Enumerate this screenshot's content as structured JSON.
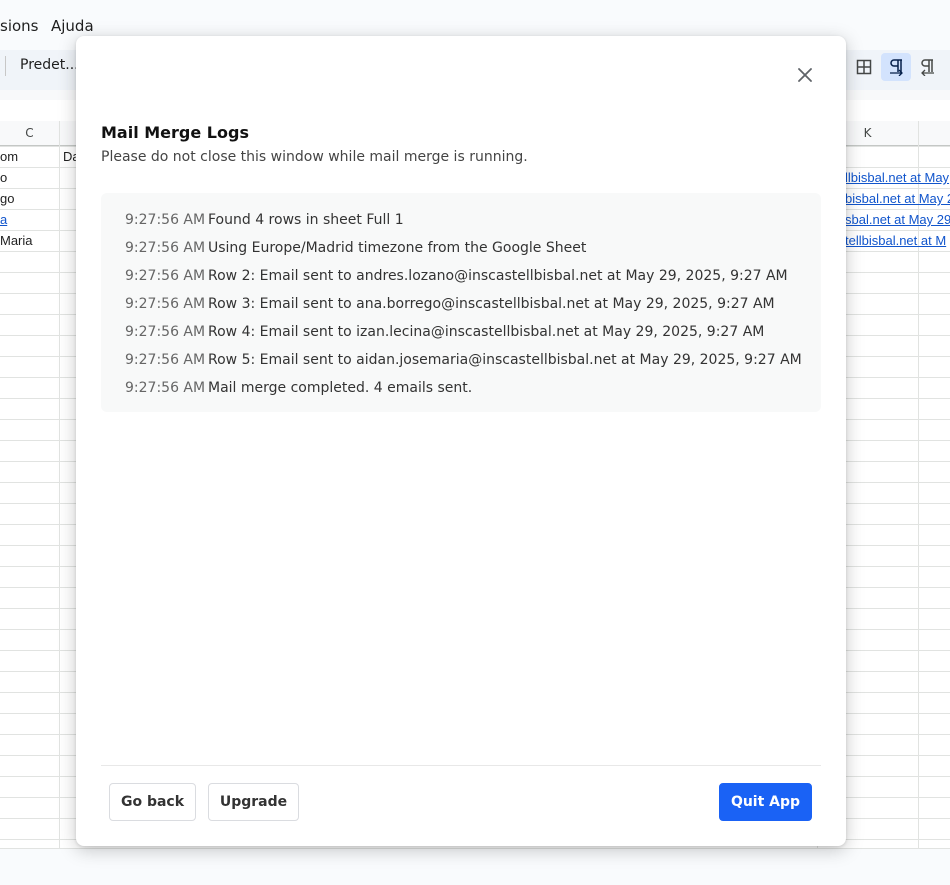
{
  "menubar": {
    "items": [
      "sions",
      "Ajuda"
    ]
  },
  "toolbar": {
    "font_name": "Predet..."
  },
  "sheet": {
    "column_headers": {
      "c": "C",
      "k": "K"
    },
    "column_c_rows": [
      "om",
      "o",
      "go",
      "a",
      "Maria"
    ],
    "column_d_rows": [
      "Da"
    ],
    "column_k_rows": [
      "llbisbal.net at May",
      "bisbal.net at May 2",
      "sbal.net at May 29",
      "tellbisbal.net at M"
    ]
  },
  "modal": {
    "title": "Mail Merge Logs",
    "subtitle": "Please do not close this window while mail merge is running.",
    "logs": [
      {
        "time": "9:27:56 AM",
        "message": "Found 4 rows in sheet Full 1"
      },
      {
        "time": "9:27:56 AM",
        "message": "Using Europe/Madrid timezone from the Google Sheet"
      },
      {
        "time": "9:27:56 AM",
        "message": "Row 2: Email sent to andres.lozano@inscastellbisbal.net at May 29, 2025, 9:27 AM"
      },
      {
        "time": "9:27:56 AM",
        "message": "Row 3: Email sent to ana.borrego@inscastellbisbal.net at May 29, 2025, 9:27 AM"
      },
      {
        "time": "9:27:56 AM",
        "message": "Row 4: Email sent to izan.lecina@inscastellbisbal.net at May 29, 2025, 9:27 AM"
      },
      {
        "time": "9:27:56 AM",
        "message": "Row 5: Email sent to aidan.josemaria@inscastellbisbal.net at May 29, 2025, 9:27 AM"
      },
      {
        "time": "9:27:56 AM",
        "message": "Mail merge completed. 4 emails sent."
      }
    ],
    "buttons": {
      "go_back": "Go back",
      "upgrade": "Upgrade",
      "quit": "Quit App"
    }
  },
  "icons": {
    "close": "close-icon",
    "borders": "borders-icon",
    "ltr": "text-direction-ltr-icon",
    "rtl": "text-direction-rtl-icon"
  },
  "colors": {
    "primary_button": "#1a62f5",
    "link": "#1155cc",
    "active_toolbar": "#d3e3fd"
  }
}
